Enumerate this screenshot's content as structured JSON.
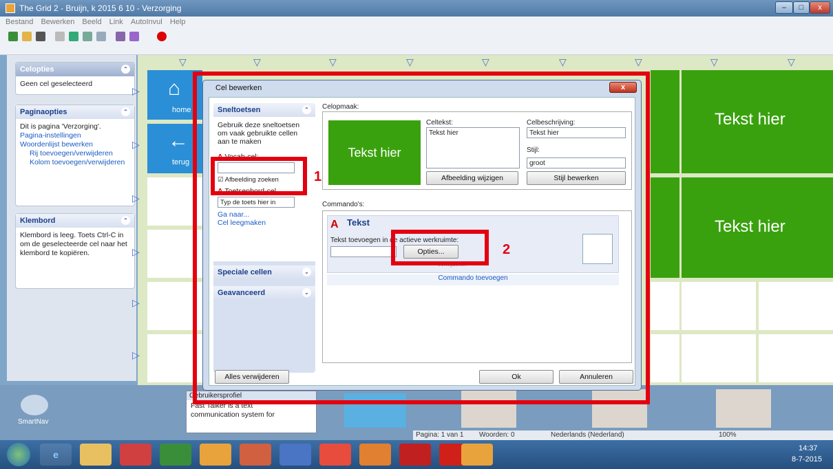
{
  "window": {
    "title": "The Grid 2 - Bruijn, k  2015  6 10 - Verzorging",
    "min": "–",
    "max": "□",
    "close": "x"
  },
  "menu": [
    "Bestand",
    "Bewerken",
    "Beeld",
    "Link",
    "AutoInvul",
    "Help"
  ],
  "sidebar": {
    "celopties": {
      "title": "Celopties",
      "text": "Geen cel geselecteerd"
    },
    "paginaopties": {
      "title": "Paginaopties",
      "text": "Dit is pagina 'Verzorging'.",
      "links": [
        "Pagina-instellingen",
        "Woordenlijst bewerken",
        "Rij toevoegen/verwijderen",
        "Kolom toevoegen/verwijderen"
      ]
    },
    "klembord": {
      "title": "Klembord",
      "text": "Klembord is leeg. Toets Ctrl-C in om de geselecteerde cel naar het klembord te kopiëren."
    }
  },
  "grid": {
    "home_label": "home",
    "back_label": "terug",
    "cell_text": "Tekst hier"
  },
  "dialog": {
    "title": "Cel bewerken",
    "close": "x",
    "sneltoetsen": {
      "title": "Sneltoetsen",
      "desc": "Gebruik deze sneltoetsen om vaak gebruikte cellen aan te maken",
      "vocab": "Vocab-cel:",
      "afbeelding": "Afbeelding zoeken",
      "toetsenbord": "Toetsenbord-cel",
      "select": "Typ de toets hier in",
      "ganaar": "Ga naar...",
      "leeg": "Cel leegmaken"
    },
    "speciale": "Speciale cellen",
    "geavanceerd": "Geavanceerd",
    "celopmaak": "Celopmaak:",
    "preview": "Tekst hier",
    "celtekst_label": "Celtekst:",
    "celtekst_value": "Tekst hier",
    "beschrijving_label": "Celbeschrijving:",
    "beschrijving_value": "Tekst hier",
    "stijl_label": "Stijl:",
    "stijl_value": "groot",
    "afbeelding_btn": "Afbeelding wijzigen",
    "stijl_btn": "Stijl bewerken",
    "commandos": "Commando's:",
    "cmd_title": "Tekst",
    "cmd_desc": "Tekst toevoegen in de actieve werkruimte:",
    "opties": "Opties...",
    "verwijderen": "verwijderen",
    "toevoegen": "Commando toevoegen",
    "alles": "Alles verwijderen",
    "ok": "Ok",
    "annuleren": "Annuleren",
    "annot1": "1",
    "annot2": "2"
  },
  "bottom": {
    "smartnav": "SmartNav",
    "gebruikers": "Gebruikersprofiel",
    "fasttalker": "Fast Talker is a text communication system for",
    "status": [
      "Pagina: 1 van 1",
      "Woorden: 0",
      "Nederlands (Nederland)"
    ],
    "zoom": "100%"
  },
  "taskbar": {
    "time": "14:37",
    "date": "8-7-2015"
  }
}
